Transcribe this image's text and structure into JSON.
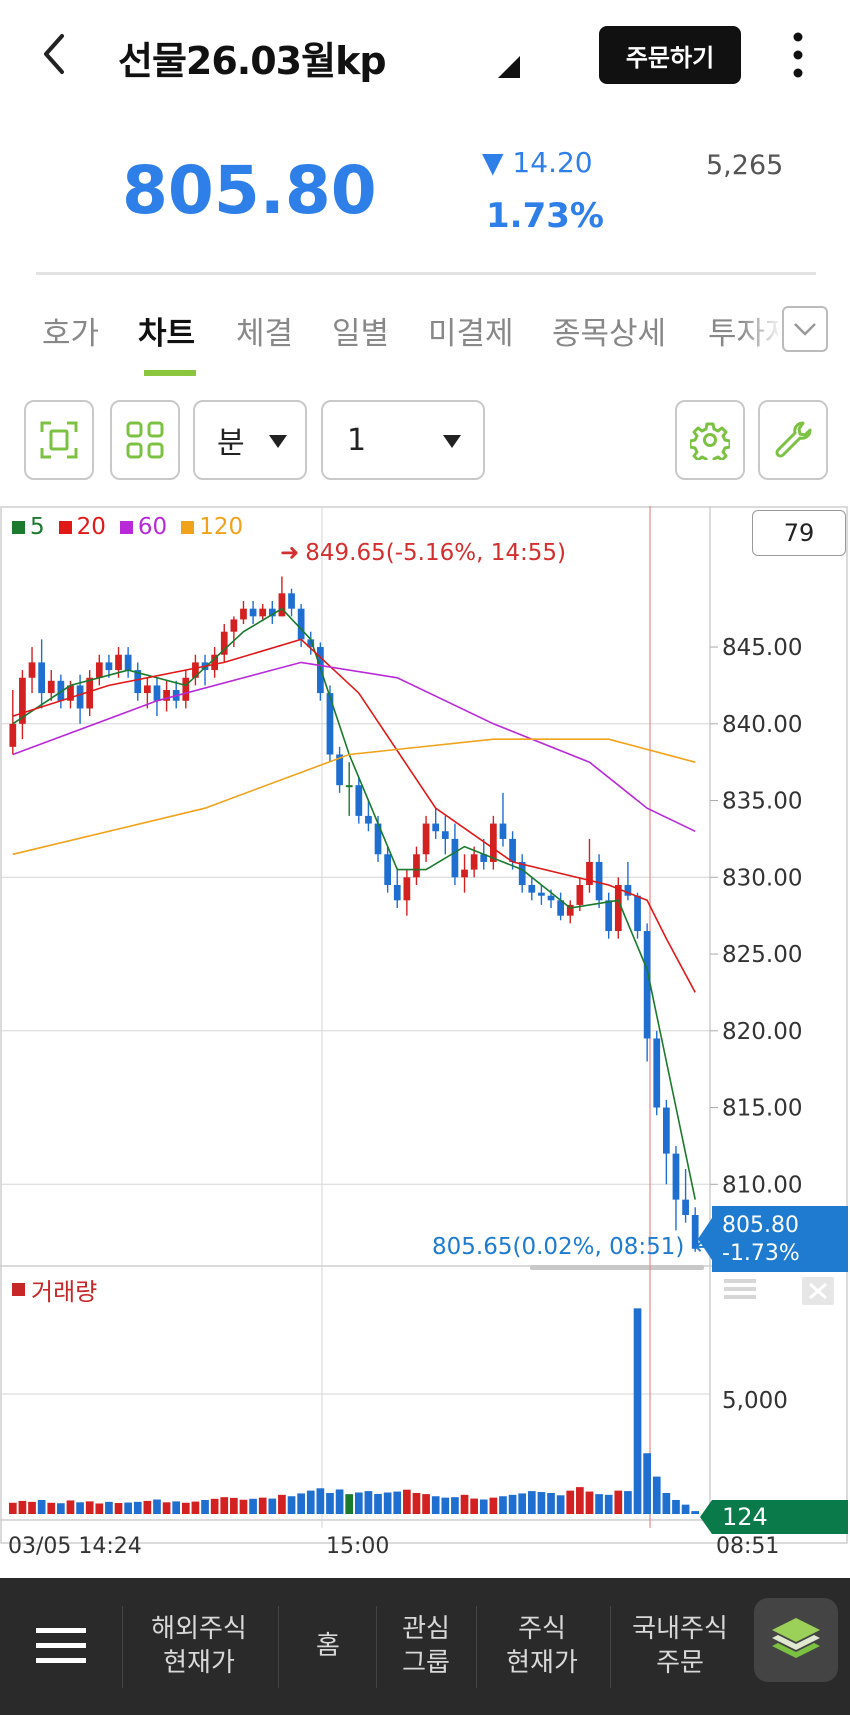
{
  "header": {
    "title": "선물26.03월kp",
    "order_label": "주문하기"
  },
  "quote": {
    "price": "805.80",
    "change_amount": "▼ 14.20",
    "change_percent": "1.73%",
    "volume": "5,265"
  },
  "tabs": [
    {
      "label": "호가",
      "active": false
    },
    {
      "label": "차트",
      "active": true
    },
    {
      "label": "체결",
      "active": false
    },
    {
      "label": "일별",
      "active": false
    },
    {
      "label": "미결제",
      "active": false
    },
    {
      "label": "종목상세",
      "active": false
    },
    {
      "label": "투자자",
      "active": false
    }
  ],
  "toolbar": {
    "period_unit": "분",
    "period_value": "1"
  },
  "chart": {
    "legend": [
      {
        "label": "5",
        "color": "#1b7a2e"
      },
      {
        "label": "20",
        "color": "#e01818"
      },
      {
        "label": "60",
        "color": "#b82ad8"
      },
      {
        "label": "120",
        "color": "#f0a21a"
      }
    ],
    "counter": "79",
    "high_annotation": "849.65(-5.16%, 14:55)",
    "low_annotation": "805.65(0.02%, 08:51)",
    "current_price": "805.80",
    "current_change": "-1.73%",
    "volume_label": "거래량",
    "volume_current": "124",
    "volume_tick": "5,000",
    "x_labels": [
      "03/05 14:24",
      "15:00",
      "08:51"
    ],
    "colors": {
      "up": "#d32020",
      "down": "#1e6fd0",
      "flat": "#1b7a2e"
    }
  },
  "chart_data": {
    "type": "candlestick",
    "y_ticks": [
      845,
      840,
      835,
      830,
      825,
      820,
      815,
      810
    ],
    "ylim": [
      805,
      851
    ],
    "candles": [
      [
        838.5,
        842.2,
        838.0,
        840.0
      ],
      [
        840.0,
        843.5,
        839.0,
        843.0
      ],
      [
        843.0,
        845.0,
        842.0,
        844.0
      ],
      [
        844.0,
        845.5,
        841.0,
        842.0
      ],
      [
        842.0,
        843.5,
        841.5,
        842.8
      ],
      [
        842.8,
        843.2,
        841.0,
        841.5
      ],
      [
        841.5,
        842.8,
        841.0,
        842.5
      ],
      [
        842.5,
        843.2,
        840.0,
        841.0
      ],
      [
        841.0,
        843.5,
        840.5,
        843.0
      ],
      [
        843.0,
        844.5,
        842.5,
        844.0
      ],
      [
        844.0,
        844.5,
        843.0,
        843.5
      ],
      [
        843.5,
        845.0,
        843.0,
        844.5
      ],
      [
        844.5,
        845.0,
        843.0,
        843.5
      ],
      [
        843.5,
        844.0,
        841.5,
        842.0
      ],
      [
        842.0,
        843.0,
        841.0,
        842.5
      ],
      [
        842.5,
        843.0,
        840.5,
        841.5
      ],
      [
        841.5,
        842.8,
        840.8,
        842.2
      ],
      [
        842.2,
        842.8,
        841.0,
        841.5
      ],
      [
        841.5,
        843.5,
        841.0,
        843.0
      ],
      [
        843.0,
        844.5,
        842.5,
        844.0
      ],
      [
        844.0,
        844.5,
        842.5,
        843.5
      ],
      [
        843.5,
        845.0,
        843.0,
        844.5
      ],
      [
        844.5,
        846.5,
        844.0,
        846.0
      ],
      [
        846.0,
        847.0,
        845.0,
        846.8
      ],
      [
        846.8,
        848.0,
        846.5,
        847.5
      ],
      [
        847.5,
        848.0,
        846.5,
        847.0
      ],
      [
        847.0,
        847.8,
        846.8,
        847.5
      ],
      [
        847.5,
        848.0,
        846.5,
        847.0
      ],
      [
        847.0,
        849.6,
        847.0,
        848.5
      ],
      [
        848.5,
        848.8,
        847.0,
        847.5
      ],
      [
        847.5,
        847.8,
        845.0,
        845.5
      ],
      [
        845.5,
        846.0,
        844.5,
        845.0
      ],
      [
        845.0,
        845.3,
        841.5,
        842.0
      ],
      [
        842.0,
        842.5,
        837.5,
        838.0
      ],
      [
        838.0,
        838.5,
        835.5,
        836.0
      ],
      [
        836.0,
        837.5,
        834.0,
        836.0
      ],
      [
        836.0,
        836.5,
        833.5,
        834.0
      ],
      [
        834.0,
        835.0,
        833.0,
        833.5
      ],
      [
        833.5,
        834.0,
        831.0,
        831.5
      ],
      [
        831.5,
        832.0,
        829.0,
        829.5
      ],
      [
        829.5,
        830.5,
        828.0,
        828.5
      ],
      [
        828.5,
        830.5,
        827.5,
        830.0
      ],
      [
        830.0,
        832.0,
        829.5,
        831.5
      ],
      [
        831.5,
        834.0,
        831.0,
        833.5
      ],
      [
        833.5,
        834.5,
        832.5,
        833.0
      ],
      [
        833.0,
        834.0,
        831.5,
        832.5
      ],
      [
        832.5,
        833.5,
        829.5,
        830.0
      ],
      [
        830.0,
        831.5,
        829.0,
        830.5
      ],
      [
        830.5,
        832.0,
        830.0,
        831.5
      ],
      [
        831.5,
        832.5,
        830.5,
        831.0
      ],
      [
        831.0,
        834.0,
        830.5,
        833.5
      ],
      [
        833.5,
        835.5,
        832.0,
        832.5
      ],
      [
        832.5,
        833.0,
        830.5,
        831.0
      ],
      [
        831.0,
        831.5,
        829.0,
        829.5
      ],
      [
        829.5,
        830.0,
        828.5,
        829.0
      ],
      [
        829.0,
        829.5,
        828.2,
        828.8
      ],
      [
        828.8,
        829.2,
        828.0,
        828.5
      ],
      [
        828.5,
        829.0,
        827.2,
        827.5
      ],
      [
        827.5,
        828.5,
        827.0,
        828.2
      ],
      [
        828.2,
        830.0,
        827.8,
        829.5
      ],
      [
        829.5,
        832.5,
        829.0,
        831.0
      ],
      [
        831.0,
        831.5,
        828.0,
        828.5
      ],
      [
        828.5,
        829.0,
        826.0,
        826.5
      ],
      [
        826.5,
        830.0,
        826.0,
        829.5
      ],
      [
        829.5,
        831.0,
        828.5,
        828.8
      ],
      [
        828.8,
        829.0,
        826.0,
        826.5
      ],
      [
        826.5,
        827.0,
        818.0,
        819.5
      ],
      [
        819.5,
        820.0,
        814.5,
        815.0
      ],
      [
        815.0,
        815.5,
        810.0,
        812.0
      ],
      [
        812.0,
        812.5,
        807.0,
        809.0
      ],
      [
        809.0,
        811.0,
        807.5,
        808.0
      ],
      [
        808.0,
        808.5,
        805.6,
        805.8
      ]
    ],
    "ma": {
      "5": [
        [
          0,
          840.0
        ],
        [
          6,
          842.5
        ],
        [
          12,
          843.5
        ],
        [
          18,
          842.5
        ],
        [
          24,
          846.0
        ],
        [
          28,
          847.5
        ],
        [
          31,
          845.5
        ],
        [
          35,
          838.0
        ],
        [
          40,
          830.5
        ],
        [
          43,
          830.5
        ],
        [
          47,
          832.0
        ],
        [
          53,
          830.5
        ],
        [
          58,
          828.0
        ],
        [
          63,
          828.5
        ],
        [
          66,
          824.0
        ],
        [
          69,
          815.0
        ],
        [
          71,
          809.0
        ]
      ],
      "20": [
        [
          0,
          840.5
        ],
        [
          10,
          842.5
        ],
        [
          22,
          844.0
        ],
        [
          30,
          845.5
        ],
        [
          36,
          842.0
        ],
        [
          44,
          834.5
        ],
        [
          52,
          831.0
        ],
        [
          62,
          829.5
        ],
        [
          66,
          828.5
        ],
        [
          68,
          826.0
        ],
        [
          71,
          822.5
        ]
      ],
      "60": [
        [
          0,
          838.0
        ],
        [
          15,
          841.5
        ],
        [
          30,
          844.0
        ],
        [
          40,
          843.0
        ],
        [
          50,
          840.0
        ],
        [
          60,
          837.5
        ],
        [
          66,
          834.5
        ],
        [
          71,
          833.0
        ]
      ],
      "120": [
        [
          0,
          831.5
        ],
        [
          20,
          834.5
        ],
        [
          35,
          838.0
        ],
        [
          50,
          839.0
        ],
        [
          62,
          839.0
        ],
        [
          71,
          837.5
        ]
      ]
    },
    "volume": [
      [
        0,
        1
      ],
      [
        1,
        1
      ],
      [
        2,
        0
      ],
      [
        3,
        0
      ],
      [
        4,
        0
      ],
      [
        5,
        1
      ],
      [
        6,
        0
      ],
      [
        7,
        0
      ],
      [
        8,
        1
      ],
      [
        9,
        1
      ],
      [
        10,
        0
      ],
      [
        11,
        1
      ],
      [
        12,
        0
      ],
      [
        13,
        0
      ],
      [
        14,
        1
      ],
      [
        15,
        0
      ],
      [
        16,
        2
      ],
      [
        17,
        0
      ],
      [
        18,
        1
      ],
      [
        19,
        1
      ],
      [
        20,
        0
      ],
      [
        21,
        1
      ],
      [
        22,
        1
      ],
      [
        23,
        1
      ],
      [
        24,
        1
      ],
      [
        25,
        0
      ],
      [
        26,
        1
      ],
      [
        27,
        0
      ],
      [
        28,
        1
      ],
      [
        29,
        0
      ],
      [
        30,
        0
      ],
      [
        31,
        0
      ],
      [
        32,
        0
      ],
      [
        33,
        0
      ],
      [
        34,
        0
      ],
      [
        35,
        0
      ],
      [
        36,
        0
      ],
      [
        37,
        0
      ],
      [
        38,
        0
      ],
      [
        39,
        0
      ],
      [
        40,
        1
      ],
      [
        41,
        1
      ],
      [
        42,
        1
      ],
      [
        43,
        1
      ],
      [
        44,
        1
      ],
      [
        45,
        1
      ],
      [
        46,
        0
      ],
      [
        47,
        0
      ],
      [
        48,
        0
      ],
      [
        49,
        1
      ],
      [
        50,
        1
      ],
      [
        51,
        0
      ],
      [
        52,
        0
      ],
      [
        53,
        0
      ],
      [
        54,
        0
      ],
      [
        55,
        0
      ],
      [
        56,
        0
      ],
      [
        57,
        0
      ],
      [
        58,
        1
      ],
      [
        59,
        1
      ],
      [
        60,
        1
      ],
      [
        61,
        0
      ],
      [
        62,
        0
      ],
      [
        63,
        1
      ],
      [
        64,
        0
      ],
      [
        65,
        0
      ],
      [
        66,
        0
      ],
      [
        67,
        0
      ],
      [
        68,
        0
      ],
      [
        69,
        0
      ],
      [
        70,
        0
      ],
      [
        71,
        0
      ]
    ],
    "volume_values": [
      480,
      560,
      520,
      600,
      480,
      460,
      580,
      500,
      540,
      450,
      520,
      470,
      490,
      520,
      560,
      620,
      500,
      540,
      480,
      530,
      600,
      650,
      720,
      690,
      610,
      650,
      700,
      660,
      820,
      760,
      880,
      1000,
      1100,
      900,
      1050,
      850,
      920,
      980,
      860,
      920,
      960,
      1040,
      900,
      850,
      760,
      700,
      720,
      820,
      660,
      620,
      700,
      760,
      820,
      880,
      980,
      940,
      900,
      800,
      1000,
      1150,
      960,
      850,
      820,
      1000,
      980,
      8800,
      2600,
      1600,
      900,
      600,
      400,
      124
    ],
    "volume_tick": 5000
  },
  "bottom_nav": {
    "items": [
      "해외주식\n현재가",
      "홈",
      "관심\n그룹",
      "주식\n현재가",
      "국내주식\n주문"
    ]
  }
}
